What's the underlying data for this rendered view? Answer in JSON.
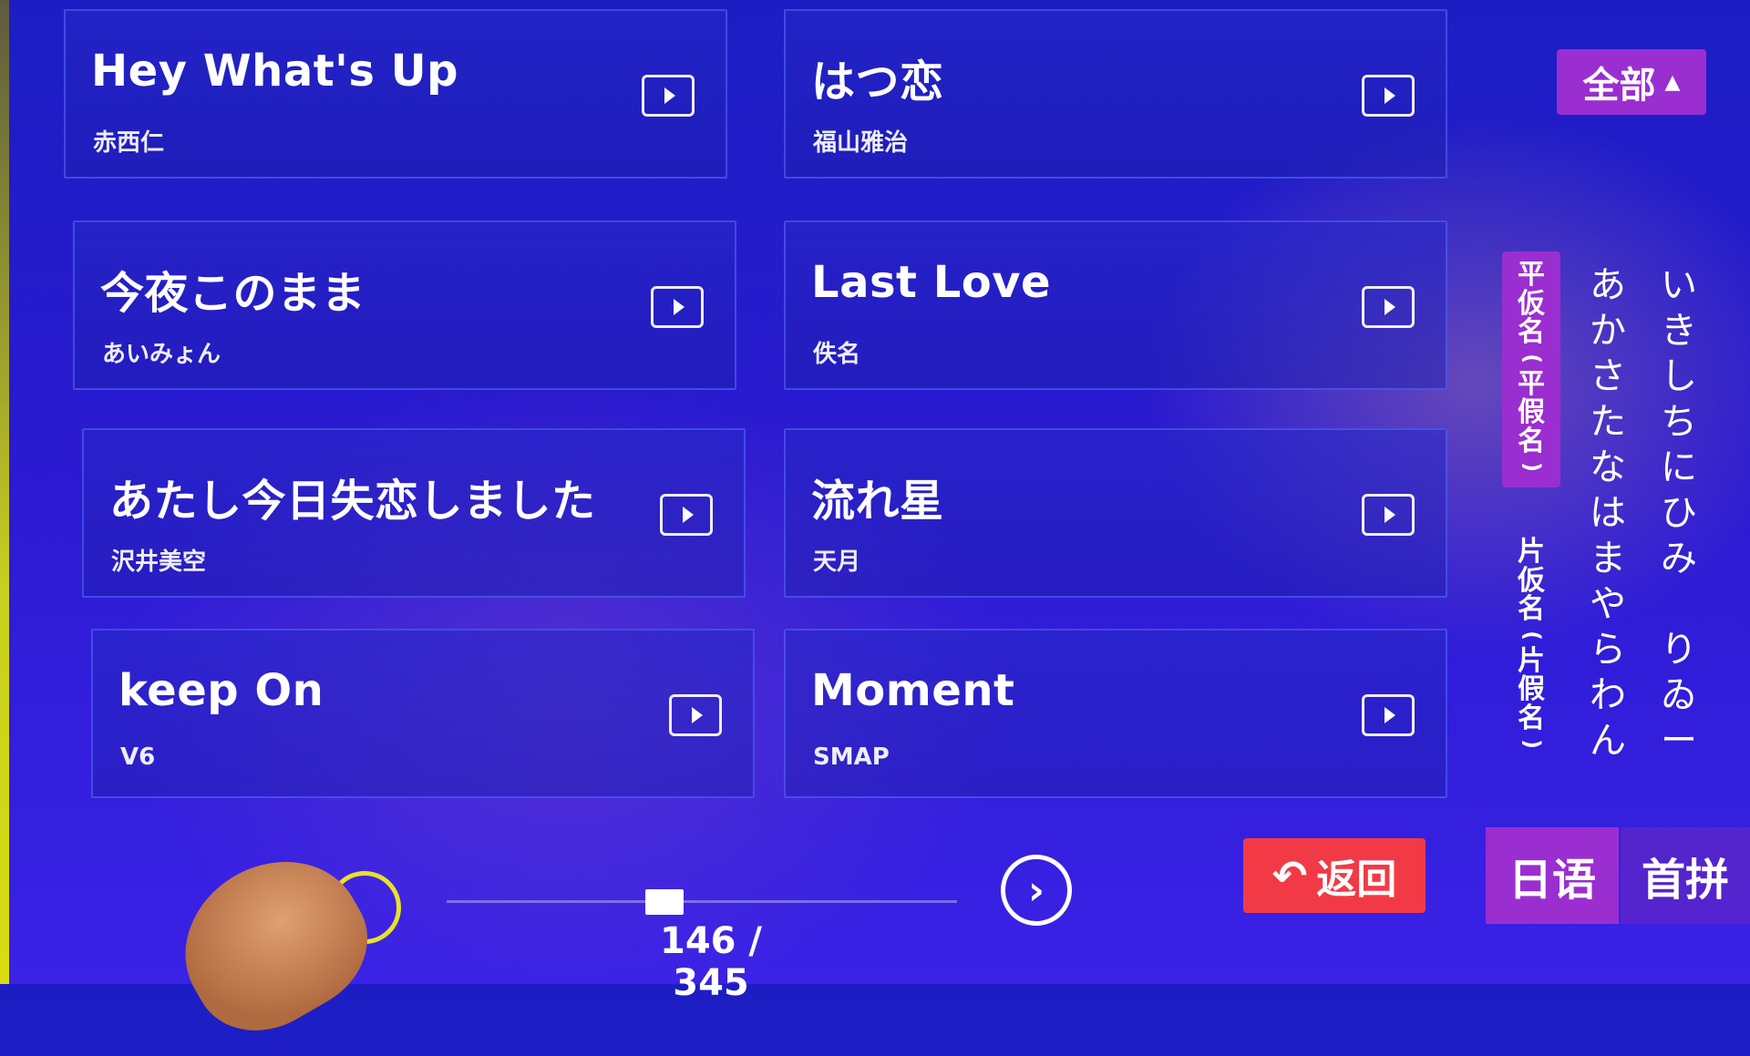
{
  "songs": [
    {
      "title": "Hey What's Up",
      "artist": "赤西仁"
    },
    {
      "title": "はつ恋",
      "artist": "福山雅治"
    },
    {
      "title": "今夜このまま",
      "artist": "あいみょん"
    },
    {
      "title": "Last Love",
      "artist": "佚名"
    },
    {
      "title": "あたし今日失恋しました",
      "artist": "沢井美空"
    },
    {
      "title": "流れ星",
      "artist": "天月"
    },
    {
      "title": "keep On",
      "artist": "V6"
    },
    {
      "title": "Moment",
      "artist": "SMAP"
    }
  ],
  "filter": {
    "label": "全部",
    "caret": "▲"
  },
  "kana": {
    "hiragana_tab": "平仮名(平假名)",
    "katakana_tab": "片仮名(片假名)",
    "column1": [
      "あ",
      "か",
      "さ",
      "た",
      "な",
      "は",
      "ま",
      "や",
      "ら",
      "わ",
      "ん"
    ],
    "column2": [
      "い",
      "き",
      "し",
      "ち",
      "に",
      "ひ",
      "み",
      "",
      "り",
      "ゐ",
      "ー"
    ]
  },
  "bottom_tabs": {
    "japanese": "日语",
    "initials": "首拼"
  },
  "back_button": {
    "label": "返回"
  },
  "pager": {
    "indicator": "146 / 345",
    "current": 146,
    "total": 345,
    "next": "›"
  },
  "icons": {
    "play": "play-icon",
    "back": "back-arrow-icon",
    "next": "chevron-right-icon"
  }
}
